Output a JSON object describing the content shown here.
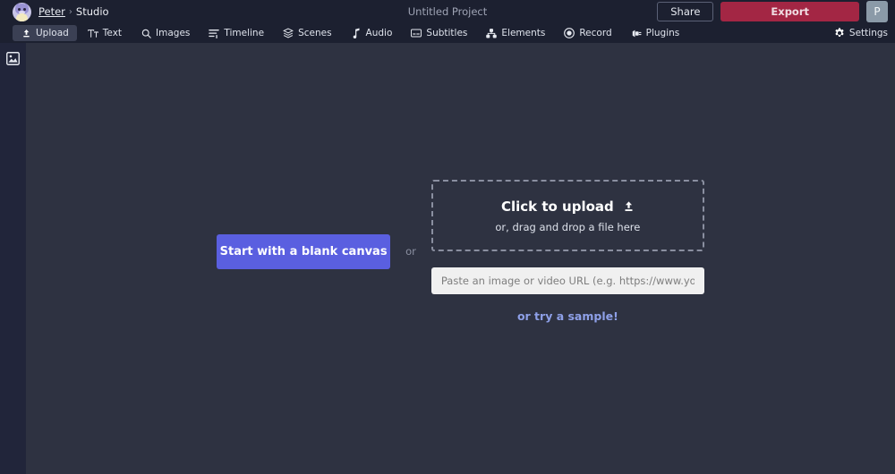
{
  "topbar": {
    "avatar_name": "user-avatar",
    "breadcrumb": {
      "user": "Peter",
      "separator": "›",
      "section": "Studio"
    },
    "project_title": "Untitled Project",
    "share_label": "Share",
    "export_label": "Export",
    "profile_initial": "P"
  },
  "nav": {
    "tabs": [
      {
        "label": "Upload",
        "icon": "upload-icon",
        "active": true
      },
      {
        "label": "Text",
        "icon": "text-icon",
        "active": false
      },
      {
        "label": "Images",
        "icon": "search-icon",
        "active": false
      },
      {
        "label": "Timeline",
        "icon": "timeline-icon",
        "active": false
      },
      {
        "label": "Scenes",
        "icon": "layers-icon",
        "active": false
      },
      {
        "label": "Audio",
        "icon": "music-note-icon",
        "active": false
      },
      {
        "label": "Subtitles",
        "icon": "subtitles-icon",
        "active": false
      },
      {
        "label": "Elements",
        "icon": "elements-icon",
        "active": false
      },
      {
        "label": "Record",
        "icon": "record-icon",
        "active": false
      },
      {
        "label": "Plugins",
        "icon": "plug-icon",
        "active": false
      }
    ],
    "settings_label": "Settings",
    "settings_icon": "gear-icon"
  },
  "left_rail": {
    "items": [
      {
        "icon": "image-icon",
        "name": "media-panel-toggle"
      }
    ]
  },
  "main": {
    "blank_canvas_label": "Start with a blank canvas",
    "or_label": "or",
    "dropzone": {
      "title": "Click to upload",
      "icon": "upload-arrow-icon",
      "subtitle": "or, drag and drop a file here"
    },
    "url_field": {
      "placeholder": "Paste an image or video URL (e.g. https://www.youtube.com/",
      "value": ""
    },
    "sample_link": "or try a sample!"
  },
  "colors": {
    "topbar_bg": "#1c2030",
    "canvas_bg": "#2e3241",
    "rail_bg": "#21253a",
    "accent_primary": "#5a5fe0",
    "accent_export": "#a32644",
    "link": "#8ea0e8",
    "profile_badge": "#8b9aa8"
  }
}
